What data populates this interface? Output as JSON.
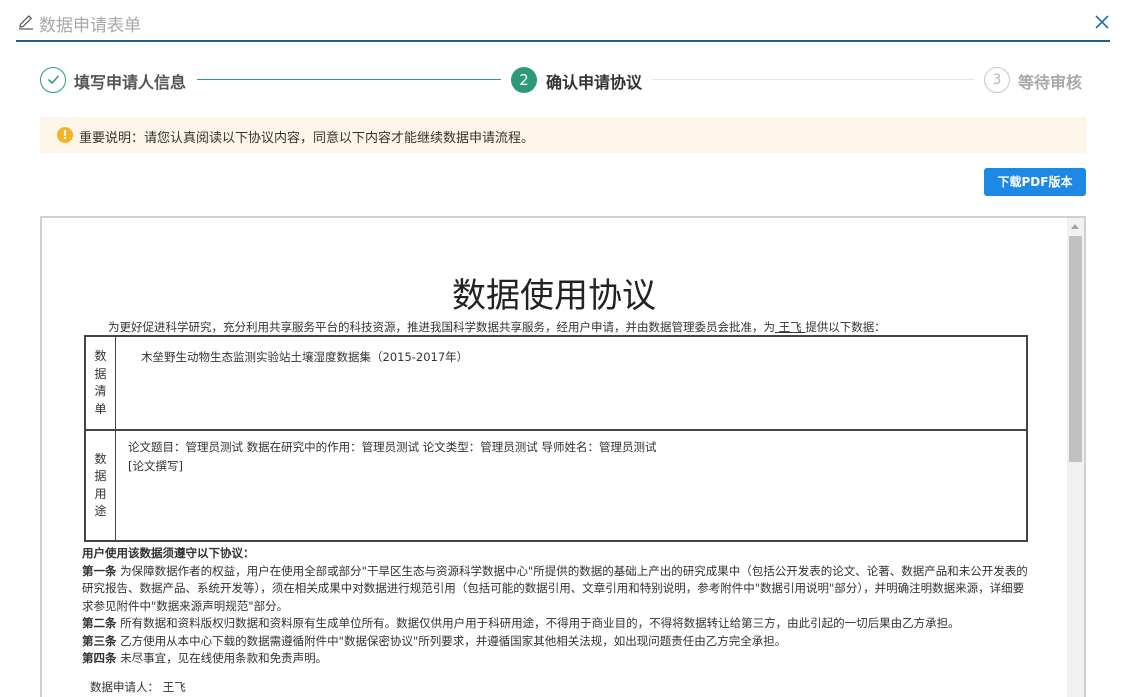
{
  "dialog": {
    "title": "数据申请表单",
    "close_icon": "close-icon",
    "edit_icon": "pencil-icon"
  },
  "steps": [
    {
      "index": "1",
      "label": "填写申请人信息",
      "state": "done"
    },
    {
      "index": "2",
      "label": "确认申请协议",
      "state": "active"
    },
    {
      "index": "3",
      "label": "等待审核",
      "state": "pending"
    }
  ],
  "notice": {
    "icon": "warning-icon",
    "text": "重要说明：请您认真阅读以下协议内容，同意以下内容才能继续数据申请流程。"
  },
  "download_button": "下载PDF版本",
  "agreement": {
    "title": "数据使用协议",
    "intro_prefix": "为更好促进科学研究，充分利用共享服务平台的科技资源，推进我国科学数据共享服务，经用户申请，并由数据管理委员会批准，为",
    "intro_user": "  王飞  ",
    "intro_suffix": "提供以下数据：",
    "table": {
      "row1_label": [
        "数",
        "据",
        "清",
        "单"
      ],
      "row1_text": "木垒野生动物生态监测实验站土壤湿度数据集（2015-2017年）",
      "row2_label": [
        "数",
        "据",
        "用",
        "途"
      ],
      "row2_text1": "论文题目：管理员测试 数据在研究中的作用：管理员测试 论文类型：管理员测试 导师姓名：管理员测试",
      "row2_text2": "[论文撰写]"
    },
    "clauses_intro": "用户使用该数据须遵守以下协议：",
    "clauses": [
      {
        "head": "第一条",
        "text": " 为保障数据作者的权益，用户在使用全部或部分\"干旱区生态与资源科学数据中心\"所提供的数据的基础上产出的研究成果中（包括公开发表的论文、论著、数据产品和未公开发表的研究报告、数据产品、系统开发等），须在相关成果中对数据进行规范引用（包括可能的数据引用、文章引用和特别说明，参考附件中\"数据引用说明\"部分），并明确注明数据来源，详细要求参见附件中\"数据来源声明规范\"部分。"
      },
      {
        "head": "第二条",
        "text": " 所有数据和资料版权归数据和资料原有生成单位所有。数据仅供用户用于科研用途，不得用于商业目的，不得将数据转让给第三方，由此引起的一切后果由乙方承担。"
      },
      {
        "head": "第三条",
        "text": " 乙方使用从本中心下载的数据需遵循附件中\"数据保密协议\"所列要求，并遵循国家其他相关法规，如出现问题责任由乙方完全承担。"
      },
      {
        "head": "第四条",
        "text": " 未尽事宜，见在线使用条款和免责声明。"
      }
    ],
    "signer_label": "数据申请人：",
    "signer_name": "王飞"
  }
}
